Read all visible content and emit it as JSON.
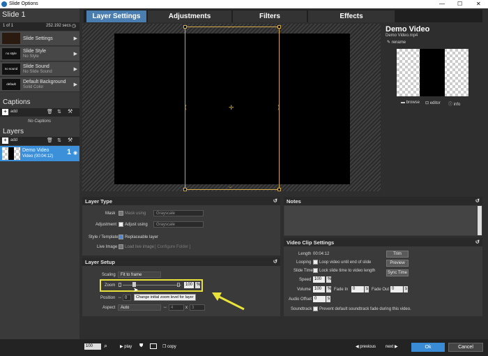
{
  "window": {
    "title": "Slide Options",
    "minimize": "—",
    "maximize": "☐",
    "close": "✕"
  },
  "slide": {
    "title": "Slide 1",
    "counter": "1 of 1",
    "duration": "252.192 secs"
  },
  "sidebar": {
    "items": [
      {
        "label": "Slide Settings",
        "sub": "",
        "thumb": ""
      },
      {
        "label": "Slide Style",
        "sub": "No Style",
        "thumb": "no style"
      },
      {
        "label": "Slide Sound",
        "sub": "No Slide Sound",
        "thumb": "no sound"
      },
      {
        "label": "Default Background",
        "sub": "Solid Color",
        "thumb": "default"
      }
    ]
  },
  "captions": {
    "title": "Captions",
    "add": "add",
    "empty": "No Captions"
  },
  "layers": {
    "title": "Layers",
    "add": "add",
    "items": [
      {
        "name": "Demo Video",
        "sub": "Video (00:04:12)",
        "number": "1"
      }
    ]
  },
  "tabs": [
    "Layer Settings",
    "Adjustments",
    "Filters",
    "Effects"
  ],
  "media": {
    "title": "Demo Video",
    "filename": "Demo Video.mp4",
    "rename": "rename",
    "browse": "browse",
    "editor": "editor",
    "info": "info"
  },
  "layer_type": {
    "title": "Layer Type",
    "mask_label": "Mask",
    "mask_check": "Mask using",
    "mask_value": "Grayscale",
    "adjustment_label": "Adjustment",
    "adjustment_check": "Adjust using",
    "adjustment_value": "Grayscale",
    "style_label": "Style / Template",
    "style_check": "Replaceable layer",
    "live_label": "Live Image",
    "live_check": "Load live image",
    "live_folder": "[ Configure Folder ]"
  },
  "notes": {
    "title": "Notes"
  },
  "layer_setup": {
    "title": "Layer Setup",
    "scaling_label": "Scaling",
    "scaling_value": "Fit to frame",
    "zoom_label": "Zoom",
    "zoom_value": "100",
    "zoom_unit": "%",
    "zoom_tooltip": "Change initial zoom level for layer",
    "position_label": "Position",
    "position_x": "0",
    "aspect_label": "Aspect",
    "aspect_value": "Auto",
    "aspect_w": "4",
    "aspect_x": "x",
    "aspect_h": "3"
  },
  "video_clip": {
    "title": "Video Clip Settings",
    "length_label": "Length",
    "length_value": "00:04:12",
    "trim": "Trim",
    "looping_label": "Looping",
    "looping_text": "Loop video until end of slide",
    "preview": "Preview",
    "slide_time_label": "Slide Time",
    "slide_time_text": "Lock slide time to video length",
    "sync_time": "Sync Time",
    "speed_label": "Speed",
    "speed_value": "100",
    "volume_label": "Volume",
    "volume_value": "100",
    "fade_in_label": "Fade In",
    "fade_in_value": "0",
    "fade_out_label": "Fade Out",
    "fade_out_value": "0",
    "audio_offset_label": "Audio Offset",
    "audio_offset_value": "0",
    "pct": "%",
    "s": "s",
    "soundtrack_label": "Soundtrack",
    "soundtrack_text": "Prevent default soundtrack fade during this video."
  },
  "bottom": {
    "zoom_value": "100",
    "play": "play",
    "copy": "copy",
    "previous": "previous",
    "next": "next",
    "ok": "Ok",
    "cancel": "Cancel"
  },
  "colors": {
    "accent": "#4a7eb1",
    "ok_button": "#3a8bd6",
    "highlight_box": "#e8e23a",
    "selected_layer": "#3c8fd9"
  }
}
